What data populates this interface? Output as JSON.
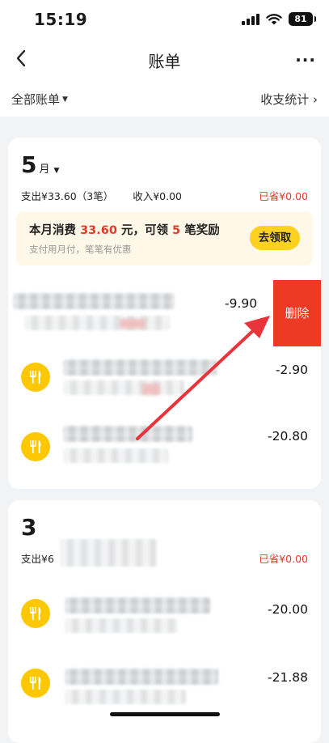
{
  "status_bar": {
    "time": "15:19",
    "battery": "81"
  },
  "nav": {
    "title": "账单",
    "more": "···",
    "back_icon": "chevron-left-icon"
  },
  "filter": {
    "all_label": "全部账单",
    "stats_label": "收支统计 ›"
  },
  "months": [
    {
      "month_number": "5",
      "month_unit": "月",
      "summary_expense": "支出¥33.60（3笔）",
      "summary_income": "收入¥0.00",
      "saved": "已省¥0.00",
      "promo": {
        "prefix": "本月消费 ",
        "amount": "33.60",
        "mid": " 元，可领 ",
        "count": "5",
        "suffix": " 笔奖励",
        "subtitle": "支付用月付，笔笔有优惠",
        "button": "去领取"
      },
      "transactions": [
        {
          "amount": "-9.90",
          "swiped": true,
          "delete_label": "删除"
        },
        {
          "amount": "-2.90",
          "icon": "fork-knife-icon"
        },
        {
          "amount": "-20.80",
          "icon": "fork-knife-icon"
        }
      ]
    },
    {
      "month_number": "3",
      "month_unit": "",
      "summary_expense": "支出¥6",
      "saved": "已省¥0.00",
      "transactions": [
        {
          "amount": "-20.00",
          "icon": "fork-knife-icon"
        },
        {
          "amount": "-21.88",
          "icon": "fork-knife-icon"
        }
      ]
    }
  ],
  "colors": {
    "accent_red": "#ed3a24",
    "saved_red": "#e43a2c",
    "icon_yellow": "#fdc800",
    "promo_button": "#fdd11f",
    "promo_bg": "#fff8e8"
  }
}
